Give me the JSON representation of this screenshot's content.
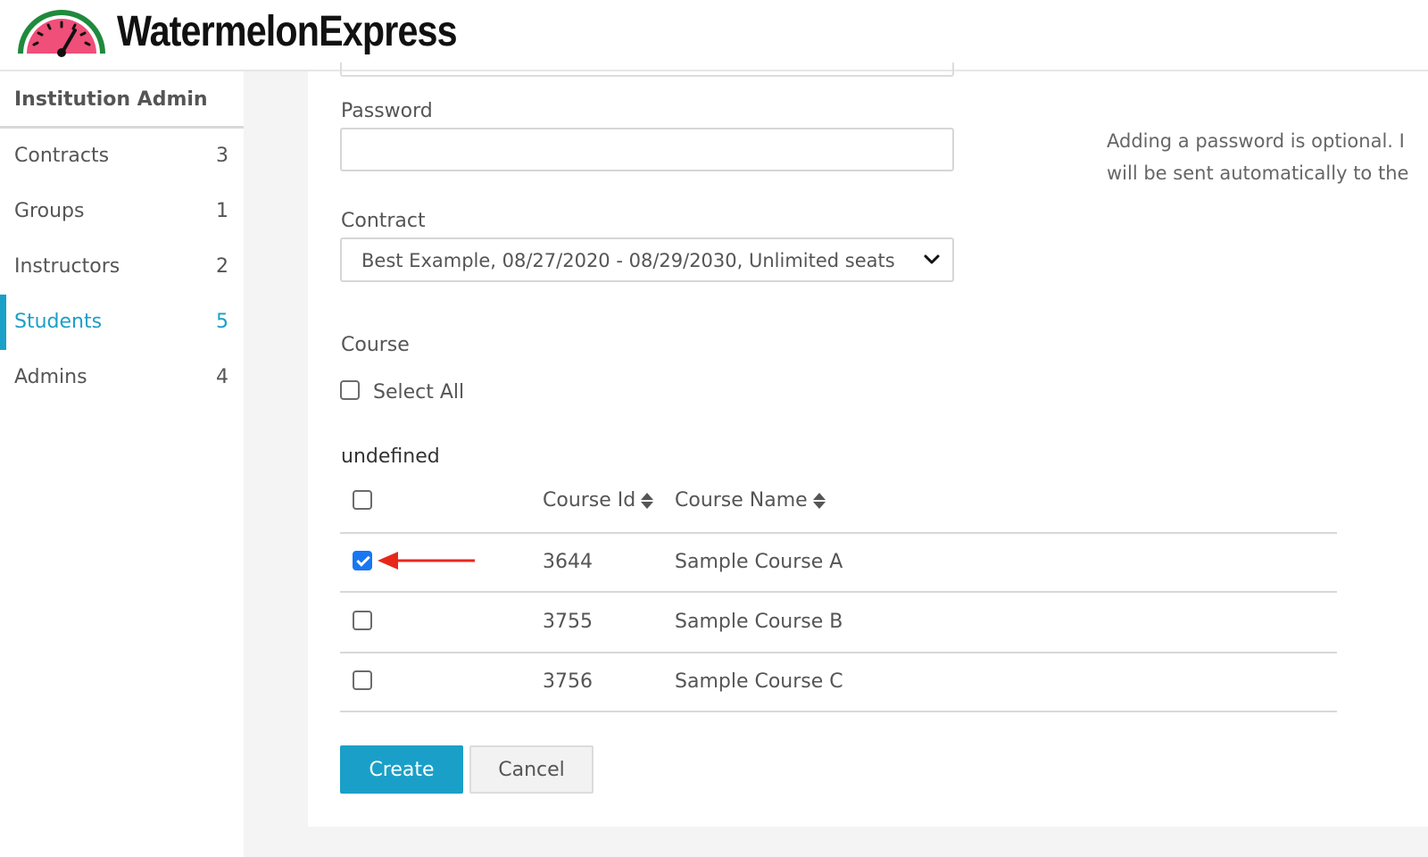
{
  "brand": {
    "name": "WatermelonExpress",
    "logo_icon": "watermelon-speedometer-icon"
  },
  "sidebar": {
    "title": "Institution Admin",
    "items": [
      {
        "label": "Contracts",
        "count": "3",
        "active": false
      },
      {
        "label": "Groups",
        "count": "1",
        "active": false
      },
      {
        "label": "Instructors",
        "count": "2",
        "active": false
      },
      {
        "label": "Students",
        "count": "5",
        "active": true
      },
      {
        "label": "Admins",
        "count": "4",
        "active": false
      }
    ]
  },
  "form": {
    "password": {
      "label": "Password",
      "value": ""
    },
    "password_help": [
      "Adding a password is optional. I",
      "will be sent automatically to the"
    ],
    "contract": {
      "label": "Contract",
      "selected": "Best Example, 08/27/2020 - 08/29/2030, Unlimited seats"
    },
    "course": {
      "label": "Course",
      "select_all_label": "Select All",
      "select_all_checked": false
    },
    "group_label": "undefined",
    "table": {
      "columns": [
        "Course Id",
        "Course Name"
      ],
      "rows": [
        {
          "id": "3644",
          "name": "Sample Course A",
          "checked": true
        },
        {
          "id": "3755",
          "name": "Sample Course B",
          "checked": false
        },
        {
          "id": "3756",
          "name": "Sample Course C",
          "checked": false
        }
      ]
    },
    "buttons": {
      "create": "Create",
      "cancel": "Cancel"
    }
  },
  "colors": {
    "accent": "#1aa0c8",
    "checkbox_checked": "#1877f2",
    "annotation_arrow": "#e8271b",
    "watermelon_flesh": "#ef4f79",
    "watermelon_rind": "#1f8a3c"
  }
}
